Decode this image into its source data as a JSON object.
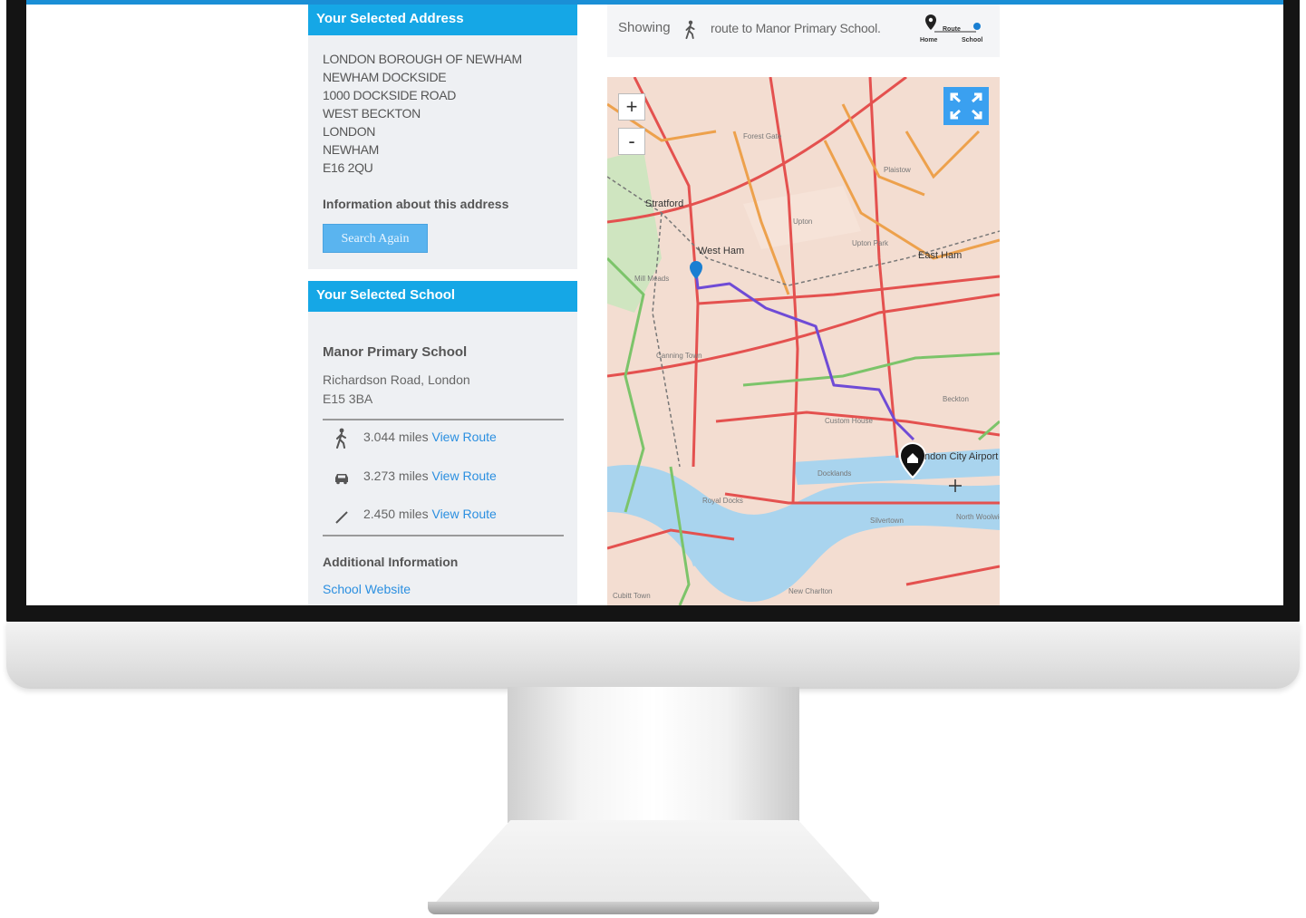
{
  "address_panel": {
    "heading": "Your Selected Address",
    "lines": [
      "LONDON BOROUGH OF NEWHAM",
      "NEWHAM DOCKSIDE",
      "1000 DOCKSIDE ROAD",
      "WEST BECKTON",
      "LONDON",
      "NEWHAM",
      "E16 2QU"
    ],
    "info_label": "Information about this address",
    "search_again": "Search Again"
  },
  "school_panel": {
    "heading": "Your Selected School",
    "name": "Manor Primary School",
    "address_line1": "Richardson Road, London",
    "address_line2": "E15 3BA",
    "routes": [
      {
        "mode": "walking-icon",
        "distance": "3.044 miles",
        "link": "View Route"
      },
      {
        "mode": "car-icon",
        "distance": "3.273 miles",
        "link": "View Route"
      },
      {
        "mode": "straight-line-icon",
        "distance": "2.450 miles",
        "link": "View Route"
      }
    ],
    "additional_heading": "Additional Information",
    "website_link": "School Website"
  },
  "route_bar": {
    "showing": "Showing",
    "route_text": "route to Manor Primary School.",
    "legend_route": "Route",
    "legend_home": "Home",
    "legend_school": "School"
  },
  "map": {
    "zoom_in": "+",
    "zoom_out": "-",
    "labels": {
      "stratford": "Stratford",
      "west_ham": "West Ham",
      "east_ham": "East Ham",
      "london_city_airport": "ndon City Airport",
      "forest_gate": "Forest Gate",
      "upton": "Upton",
      "plaistow": "Plaistow",
      "upton_park": "Upton Park",
      "canning_town": "Canning Town",
      "docklands": "Docklands",
      "custom_house": "Custom House",
      "beckton": "Beckton",
      "new_charlton": "New Charlton",
      "cubitt_town": "Cubitt Town",
      "silvertown": "Silvertown",
      "north_woolwich": "North Woolwich",
      "mill_meads": "Mill Meads",
      "royal_docks": "Royal Docks"
    },
    "route_color": "#6f4bd6",
    "water_color": "#a9d4ee"
  }
}
